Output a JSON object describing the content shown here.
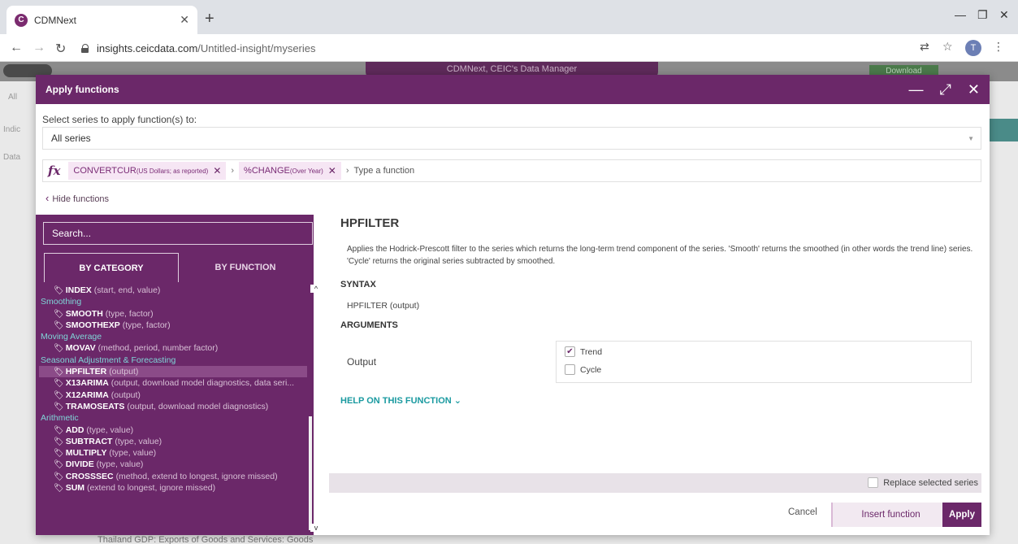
{
  "browser": {
    "tab_title": "CDMNext",
    "favicon_letter": "C",
    "url_host": "insights.ceicdata.com",
    "url_path": "/Untitled-insight/myseries",
    "profile_letter": "T"
  },
  "app_bg": {
    "title": "CDMNext, CEIC's Data Manager",
    "download": "Download",
    "bottom_text": "Thailand     GDP: Exports of Goods and Services: Goods",
    "side_labels": [
      "All",
      "Indic",
      "Data"
    ]
  },
  "modal": {
    "title": "Apply functions",
    "select_label": "Select series to apply function(s) to:",
    "select_value": "All series",
    "fx_symbol": "fx",
    "chips": [
      {
        "name": "CONVERTCUR",
        "arg": "(US Dollars; as reported)"
      },
      {
        "name": "%CHANGE",
        "arg": "(Over Year)"
      }
    ],
    "fx_placeholder": "Type a function",
    "hide_functions": "Hide functions"
  },
  "leftpanel": {
    "search_placeholder": "Search...",
    "tab_category": "BY CATEGORY",
    "tab_function": "BY FUNCTION",
    "rows": [
      {
        "kind": "item",
        "name": "INDEX",
        "args": "(start, end, value)"
      },
      {
        "kind": "cat",
        "label": "Smoothing"
      },
      {
        "kind": "item",
        "name": "SMOOTH",
        "args": "(type, factor)"
      },
      {
        "kind": "item",
        "name": "SMOOTHEXP",
        "args": "(type, factor)"
      },
      {
        "kind": "cat",
        "label": "Moving Average"
      },
      {
        "kind": "item",
        "name": "MOVAV",
        "args": "(method, period, number factor)"
      },
      {
        "kind": "cat",
        "label": "Seasonal Adjustment & Forecasting"
      },
      {
        "kind": "item",
        "name": "HPFILTER",
        "args": "(output)",
        "selected": true
      },
      {
        "kind": "item",
        "name": "X13ARIMA",
        "args": "(output, download model diagnostics, data seri..."
      },
      {
        "kind": "item",
        "name": "X12ARIMA",
        "args": "(output)"
      },
      {
        "kind": "item",
        "name": "TRAMOSEATS",
        "args": "(output, download model diagnostics)"
      },
      {
        "kind": "cat",
        "label": "Arithmetic"
      },
      {
        "kind": "item",
        "name": "ADD",
        "args": "(type, value)"
      },
      {
        "kind": "item",
        "name": "SUBTRACT",
        "args": "(type, value)"
      },
      {
        "kind": "item",
        "name": "MULTIPLY",
        "args": "(type, value)"
      },
      {
        "kind": "item",
        "name": "DIVIDE",
        "args": "(type, value)"
      },
      {
        "kind": "item",
        "name": "CROSSSEC",
        "args": "(method, extend to longest, ignore missed)"
      },
      {
        "kind": "item",
        "name": "SUM",
        "args": "(extend to longest, ignore missed)"
      }
    ]
  },
  "detail": {
    "title": "HPFILTER",
    "description": "Applies the Hodrick-Prescott filter to the series which returns the long-term trend component of the series. 'Smooth' returns the smoothed (in other words the trend line) series. 'Cycle' returns the original series subtracted by smoothed.",
    "syntax_heading": "SYNTAX",
    "syntax": "HPFILTER (output)",
    "args_heading": "ARGUMENTS",
    "arg_label": "Output",
    "options": [
      {
        "label": "Trend",
        "checked": true
      },
      {
        "label": "Cycle",
        "checked": false
      }
    ],
    "help": "HELP ON THIS FUNCTION"
  },
  "footer": {
    "replace_label": "Replace selected series",
    "cancel": "Cancel",
    "insert": "Insert function",
    "apply": "Apply"
  },
  "colors": {
    "brand_purple": "#6b2869",
    "category_teal": "#7fd6d8",
    "help_teal": "#1a9aa0"
  }
}
